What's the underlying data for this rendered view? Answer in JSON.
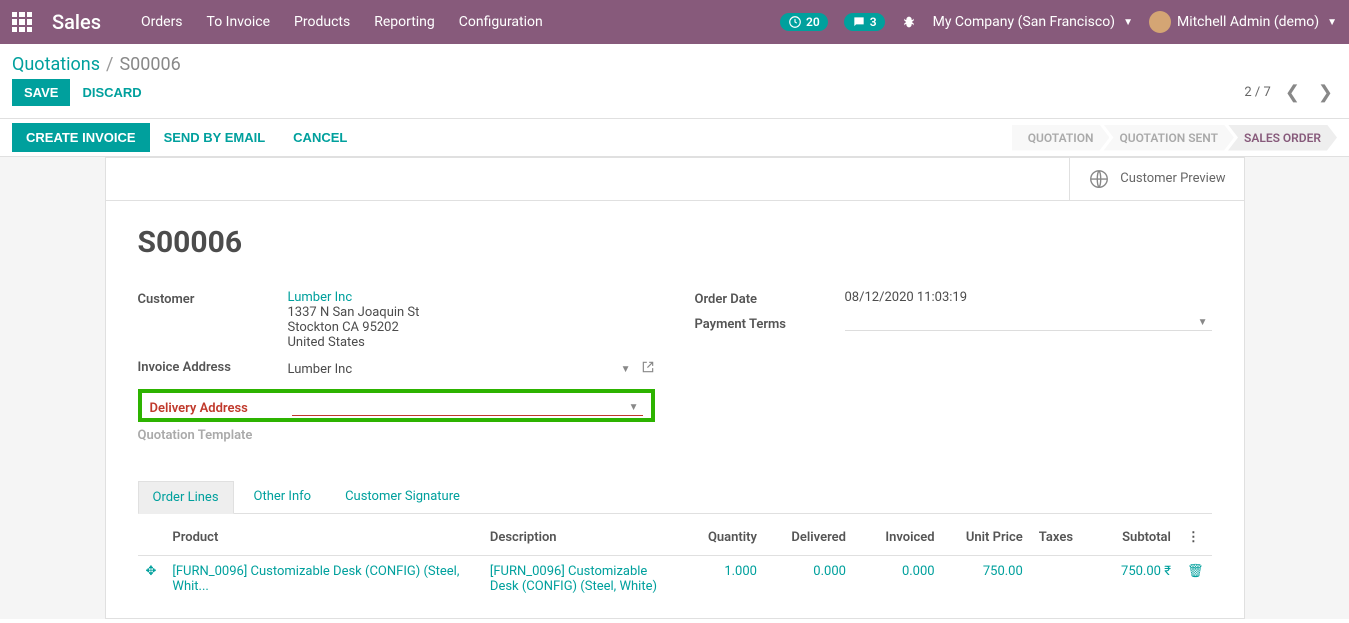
{
  "nav": {
    "app": "Sales",
    "items": [
      "Orders",
      "To Invoice",
      "Products",
      "Reporting",
      "Configuration"
    ],
    "badge1": "20",
    "badge2": "3",
    "company": "My Company (San Francisco)",
    "user": "Mitchell Admin (demo)"
  },
  "breadcrumb": {
    "root": "Quotations",
    "current": "S00006"
  },
  "actions": {
    "save": "SAVE",
    "discard": "DISCARD",
    "pager": "2 / 7"
  },
  "statusbar": {
    "create_invoice": "CREATE INVOICE",
    "send_email": "SEND BY EMAIL",
    "cancel": "CANCEL",
    "steps": [
      "QUOTATION",
      "QUOTATION SENT",
      "SALES ORDER"
    ]
  },
  "buttonbox": {
    "preview": "Customer Preview"
  },
  "order": {
    "title": "S00006",
    "customer_label": "Customer",
    "customer_name": "Lumber Inc",
    "addr1": "1337 N San Joaquin St",
    "addr2": "Stockton CA 95202",
    "addr3": "United States",
    "invoice_addr_label": "Invoice Address",
    "invoice_addr_value": "Lumber Inc",
    "delivery_addr_label": "Delivery Address",
    "quotation_tpl_label": "Quotation Template",
    "order_date_label": "Order Date",
    "order_date_value": "08/12/2020 11:03:19",
    "payment_terms_label": "Payment Terms"
  },
  "tabs": [
    "Order Lines",
    "Other Info",
    "Customer Signature"
  ],
  "grid": {
    "headers": {
      "product": "Product",
      "desc": "Description",
      "qty": "Quantity",
      "delivered": "Delivered",
      "invoiced": "Invoiced",
      "unit_price": "Unit Price",
      "taxes": "Taxes",
      "subtotal": "Subtotal"
    },
    "rows": [
      {
        "product": "[FURN_0096] Customizable Desk (CONFIG) (Steel, Whit...",
        "desc": "[FURN_0096] Customizable Desk (CONFIG) (Steel, White)",
        "qty": "1.000",
        "delivered": "0.000",
        "invoiced": "0.000",
        "unit_price": "750.00",
        "taxes": "",
        "subtotal": "750.00 ₹"
      }
    ]
  }
}
